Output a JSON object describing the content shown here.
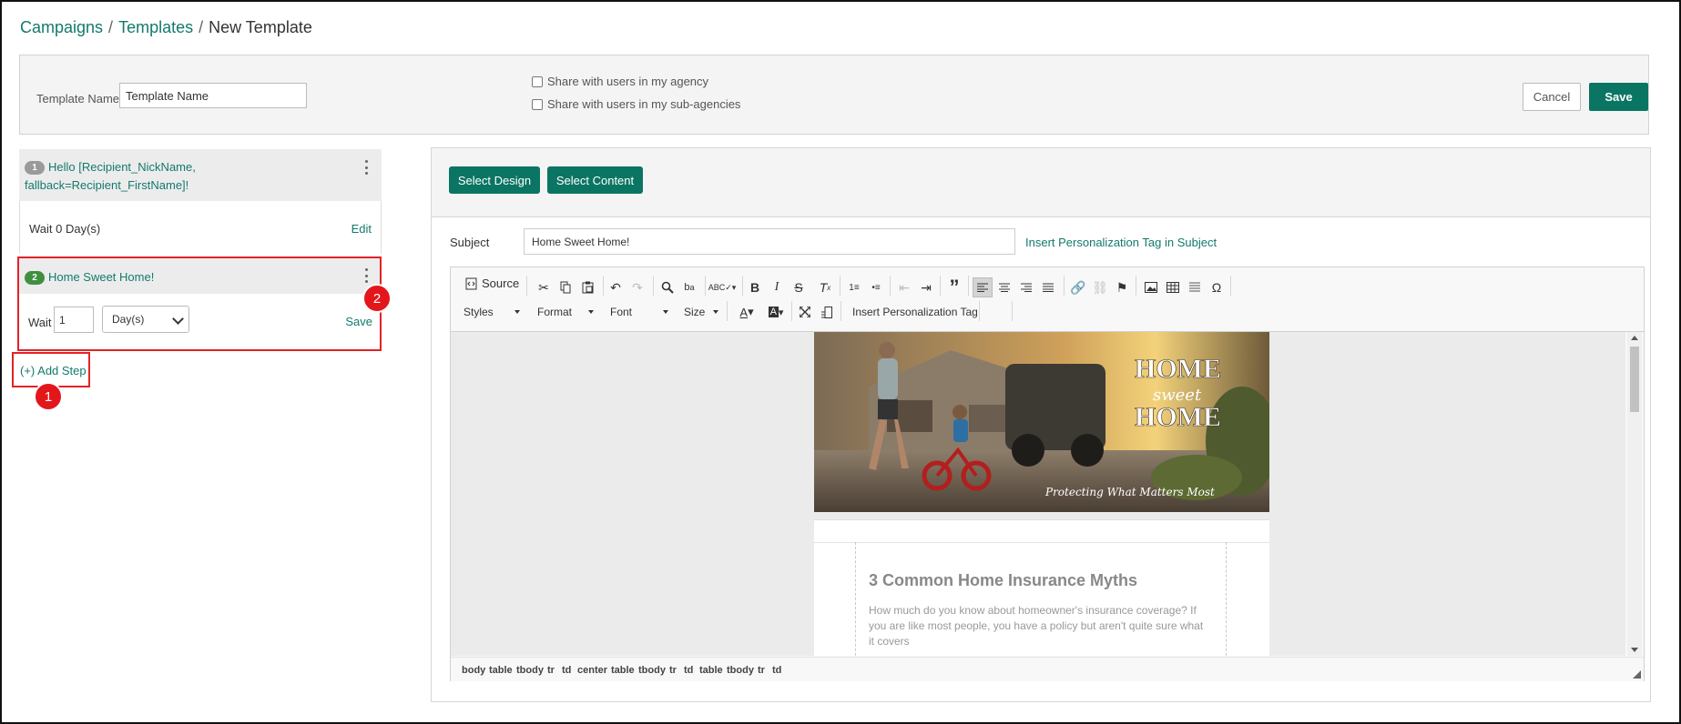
{
  "breadcrumb": {
    "campaigns": "Campaigns",
    "templates": "Templates",
    "current": "New Template",
    "sep": "/"
  },
  "template_form": {
    "name_label": "Template Name:",
    "name_value": "Template Name",
    "share_agency": "Share with users in my agency",
    "share_sub": "Share with users in my sub-agencies",
    "cancel": "Cancel",
    "save": "Save"
  },
  "steps": [
    {
      "number": "1",
      "title": "Hello [Recipient_NickName, fallback=Recipient_FirstName]!",
      "wait_text": "Wait 0 Day(s)",
      "action": "Edit"
    },
    {
      "number": "2",
      "title": "Home Sweet Home!",
      "wait_label": "Wait",
      "wait_value": "1",
      "unit": "Day(s)",
      "action": "Save"
    }
  ],
  "add_step": "(+) Add Step",
  "markers": {
    "one": "1",
    "two": "2"
  },
  "editor": {
    "select_design": "Select Design",
    "select_content": "Select Content",
    "subject_label": "Subject",
    "subject_value": "Home Sweet Home!",
    "subject_link": "Insert Personalization Tag in Subject"
  },
  "toolbar": {
    "source": "Source",
    "styles": "Styles",
    "format": "Format",
    "font": "Font",
    "size": "Size",
    "insert_tag": "Insert Personalization Tag"
  },
  "hero": {
    "line1": "HOME",
    "line2": "sweet",
    "line3": "HOME",
    "tagline": "Protecting What Matters Most"
  },
  "article": {
    "title": "3 Common Home Insurance Myths",
    "body": "How much do you know about homeowner's insurance coverage? If you are like most people, you have a policy but aren't quite sure what it covers"
  },
  "element_path": [
    "body",
    "table",
    "tbody",
    "tr",
    "td",
    "center",
    "table",
    "tbody",
    "tr",
    "td",
    "table",
    "tbody",
    "tr",
    "td"
  ],
  "colors": {
    "accent": "#0b7563",
    "link": "#137a6c",
    "highlight": "#e32228"
  }
}
